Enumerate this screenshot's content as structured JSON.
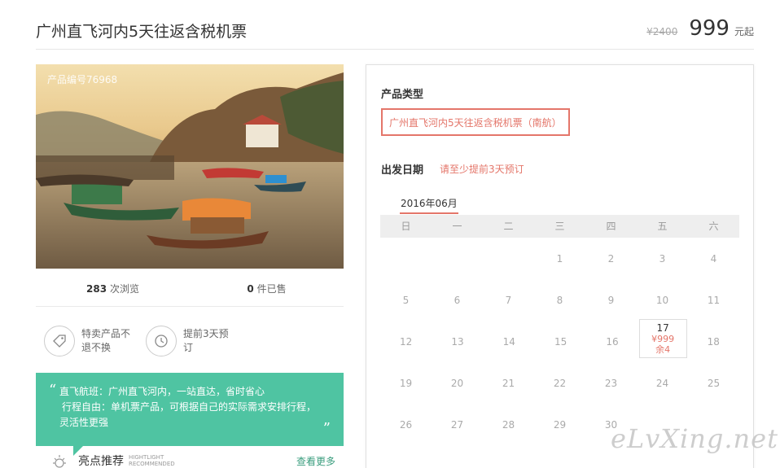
{
  "header": {
    "title": "广州直飞河内5天往返含税机票",
    "old_price": "¥2400",
    "price": "999",
    "price_unit": "元起"
  },
  "photo": {
    "product_no": "产品编号76968"
  },
  "stats": {
    "views_count": "283",
    "views_label": "次浏览",
    "sold_count": "0",
    "sold_label": "件已售"
  },
  "features": [
    {
      "icon": "tag-icon",
      "text": "特卖产品不退不换"
    },
    {
      "icon": "clock-icon",
      "text": "提前3天预订"
    }
  ],
  "intro": {
    "line1": "直飞航班：广州直飞河内，一站直达，省时省心",
    "line2": "行程自由：单机票产品，可根据自己的实际需求安排行程，",
    "line3": "灵活性更强"
  },
  "highlight": {
    "title": "亮点推荐",
    "sub1": "HIGHTLIGHT",
    "sub2": "RECOMMENDED",
    "more": "查看更多"
  },
  "booking": {
    "type_label": "产品类型",
    "type_option": "广州直飞河内5天往返含税机票（南航）",
    "date_label": "出发日期",
    "date_hint": "请至少提前3天预订",
    "month": "2016年06月",
    "weekdays": [
      "日",
      "一",
      "二",
      "三",
      "四",
      "五",
      "六"
    ],
    "weeks": [
      [
        "",
        "",
        "",
        "1",
        "2",
        "3",
        "4"
      ],
      [
        "5",
        "6",
        "7",
        "8",
        "9",
        "10",
        "11"
      ],
      [
        "12",
        "13",
        "14",
        "15",
        "16",
        "17",
        "18"
      ],
      [
        "19",
        "20",
        "21",
        "22",
        "23",
        "24",
        "25"
      ],
      [
        "26",
        "27",
        "28",
        "29",
        "30",
        "",
        ""
      ]
    ],
    "selected_day": {
      "day": "17",
      "price": "¥999",
      "remain": "余4"
    }
  },
  "watermark": "eLvXing.net",
  "colors": {
    "accent": "#e4766a",
    "green": "#4fc4a2"
  }
}
